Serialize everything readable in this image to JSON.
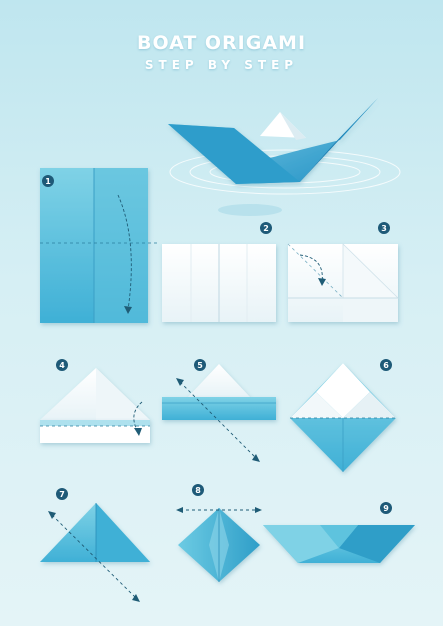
{
  "header": {
    "title": "BOAT ORIGAMI",
    "subtitle": "STEP BY STEP"
  },
  "steps": [
    {
      "number": "1"
    },
    {
      "number": "2"
    },
    {
      "number": "3"
    },
    {
      "number": "4"
    },
    {
      "number": "5"
    },
    {
      "number": "6"
    },
    {
      "number": "7"
    },
    {
      "number": "8"
    },
    {
      "number": "9"
    }
  ],
  "colors": {
    "background_top": "#bfe6ef",
    "background_bottom": "#e4f4f7",
    "paper_blue": "#5ec3de",
    "paper_blue_dark": "#2f9ec8",
    "paper_white": "#ffffff",
    "badge": "#1e5a78"
  }
}
